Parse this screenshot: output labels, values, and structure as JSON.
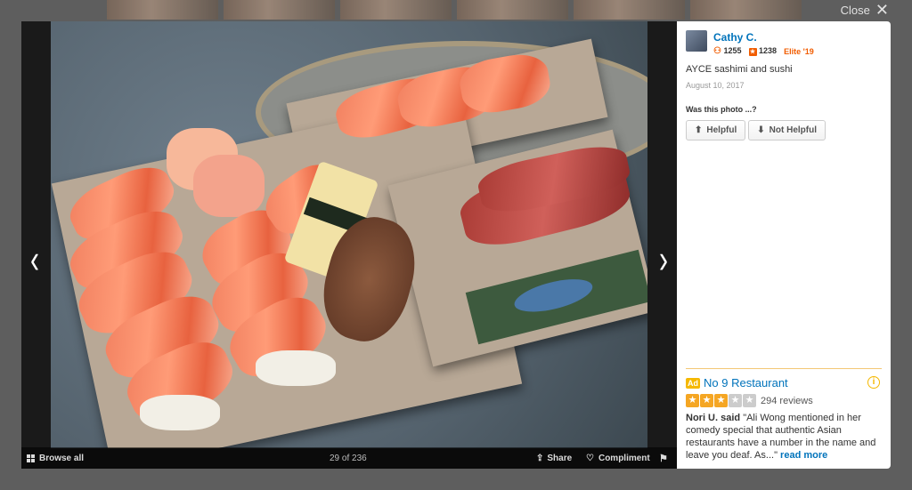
{
  "top_bar": {
    "close_label": "Close"
  },
  "viewer": {
    "browse_label": "Browse all",
    "counter": "29 of 236",
    "share_label": "Share",
    "compliment_label": "Compliment"
  },
  "photo_info": {
    "user_name": "Cathy C.",
    "friends_count": "1255",
    "reviews_count": "1238",
    "elite_label": "Elite '19",
    "caption": "AYCE sashimi and sushi",
    "date": "August 10, 2017",
    "helpful_question": "Was this photo ...?",
    "helpful_label": "Helpful",
    "not_helpful_label": "Not Helpful"
  },
  "ad": {
    "badge": "Ad",
    "business_name": "No 9 Restaurant",
    "rating": 3,
    "rating_max": 5,
    "review_count": "294 reviews",
    "reviewer": "Nori U. said",
    "snippet": "\"Ali Wong mentioned in her comedy special that authentic Asian restaurants have a number in the name and leave you deaf. As...\"",
    "read_more": "read more"
  },
  "colors": {
    "link_blue": "#0073bb",
    "yelp_orange": "#f15c00",
    "star_gold": "#f5a623"
  }
}
